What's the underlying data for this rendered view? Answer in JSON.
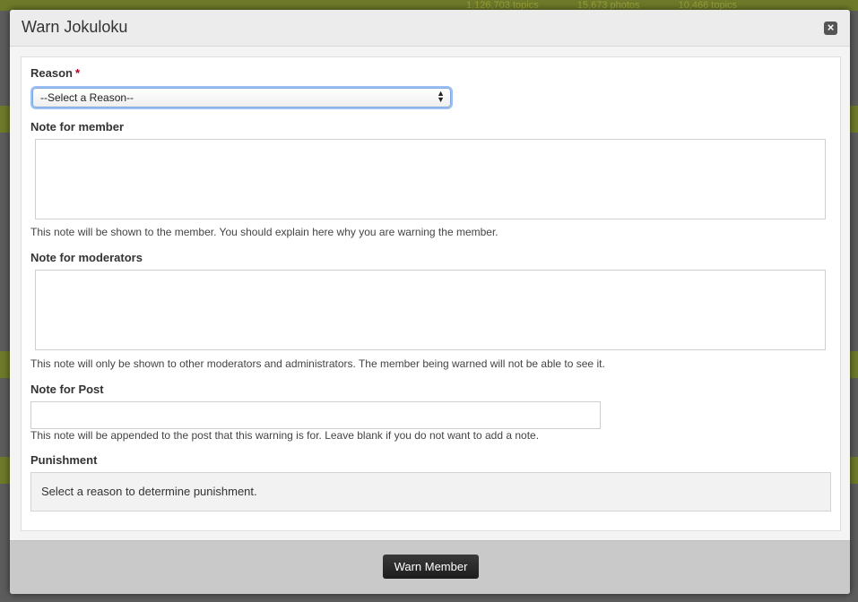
{
  "background": {
    "stats": [
      "1,126,703 topics",
      "15,673 photos",
      "10,466 topics"
    ]
  },
  "modal": {
    "title": "Warn Jokuloku",
    "close_label": "×"
  },
  "form": {
    "reason": {
      "label": "Reason",
      "required_marker": "*",
      "selected": "--Select a Reason--"
    },
    "member_note": {
      "label": "Note for member",
      "hint": "This note will be shown to the member. You should explain here why you are warning the member."
    },
    "moderator_note": {
      "label": "Note for moderators",
      "hint": "This note will only be shown to other moderators and administrators. The member being warned will not be able to see it."
    },
    "post_note": {
      "label": "Note for Post",
      "hint": "This note will be appended to the post that this warning is for. Leave blank if you do not want to add a note."
    },
    "punishment": {
      "label": "Punishment",
      "text": "Select a reason to determine punishment."
    }
  },
  "footer": {
    "submit_label": "Warn Member"
  }
}
